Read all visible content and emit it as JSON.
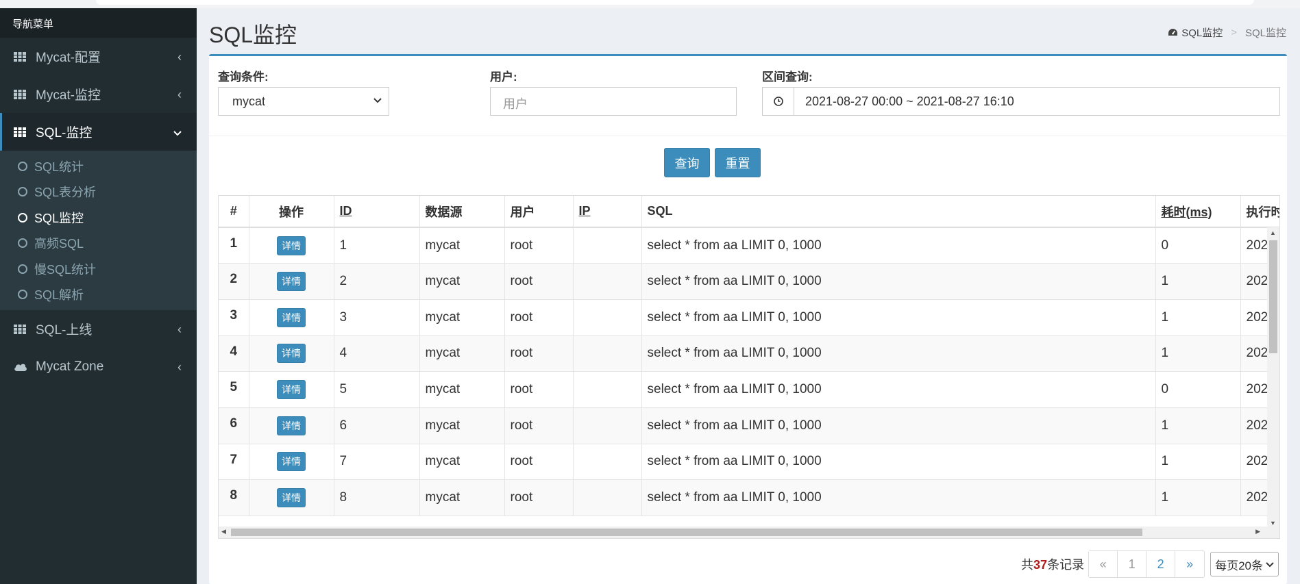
{
  "sidebar": {
    "header": "导航菜单",
    "items": [
      {
        "label": "Mycat-配置"
      },
      {
        "label": "Mycat-监控"
      },
      {
        "label": "SQL-监控"
      },
      {
        "label": "SQL-上线"
      },
      {
        "label": "Mycat Zone"
      }
    ],
    "sub_items": [
      {
        "label": "SQL统计"
      },
      {
        "label": "SQL表分析"
      },
      {
        "label": "SQL监控"
      },
      {
        "label": "高频SQL"
      },
      {
        "label": "慢SQL统计"
      },
      {
        "label": "SQL解析"
      }
    ]
  },
  "page": {
    "title": "SQL监控",
    "breadcrumb": [
      "SQL监控",
      "SQL监控"
    ]
  },
  "filters": {
    "condition_label": "查询条件:",
    "condition_value": "mycat",
    "user_label": "用户:",
    "user_placeholder": "用户",
    "range_label": "区间查询:",
    "range_value": "2021-08-27 00:00 ~ 2021-08-27 16:10"
  },
  "buttons": {
    "query": "查询",
    "reset": "重置"
  },
  "table": {
    "headers": [
      "#",
      "操作",
      "ID",
      "数据源",
      "用户",
      "IP",
      "SQL",
      "耗时(ms)",
      "执行时"
    ],
    "detail_label": "详情",
    "rows": [
      {
        "num": "1",
        "id": "1",
        "source": "mycat",
        "user": "root",
        "ip": "",
        "sql": "select * from aa LIMIT 0, 1000",
        "time": "0",
        "exec": "202"
      },
      {
        "num": "2",
        "id": "2",
        "source": "mycat",
        "user": "root",
        "ip": "",
        "sql": "select * from aa LIMIT 0, 1000",
        "time": "1",
        "exec": "202"
      },
      {
        "num": "3",
        "id": "3",
        "source": "mycat",
        "user": "root",
        "ip": "",
        "sql": "select * from aa LIMIT 0, 1000",
        "time": "1",
        "exec": "202"
      },
      {
        "num": "4",
        "id": "4",
        "source": "mycat",
        "user": "root",
        "ip": "",
        "sql": "select * from aa LIMIT 0, 1000",
        "time": "1",
        "exec": "202"
      },
      {
        "num": "5",
        "id": "5",
        "source": "mycat",
        "user": "root",
        "ip": "",
        "sql": "select * from aa LIMIT 0, 1000",
        "time": "0",
        "exec": "202"
      },
      {
        "num": "6",
        "id": "6",
        "source": "mycat",
        "user": "root",
        "ip": "",
        "sql": "select * from aa LIMIT 0, 1000",
        "time": "1",
        "exec": "202"
      },
      {
        "num": "7",
        "id": "7",
        "source": "mycat",
        "user": "root",
        "ip": "",
        "sql": "select * from aa LIMIT 0, 1000",
        "time": "1",
        "exec": "202"
      },
      {
        "num": "8",
        "id": "8",
        "source": "mycat",
        "user": "root",
        "ip": "",
        "sql": "select * from aa LIMIT 0, 1000",
        "time": "1",
        "exec": "202"
      }
    ]
  },
  "pagination": {
    "total_prefix": "共",
    "total_count": "37",
    "total_suffix": "条记录",
    "prev": "«",
    "pages": [
      "1",
      "2"
    ],
    "next": "»",
    "per_page": "每页20条"
  },
  "colors": {
    "sidebar_bg": "#222d32",
    "accent": "#3c8dbc",
    "content_bg": "#ecf0f5"
  }
}
